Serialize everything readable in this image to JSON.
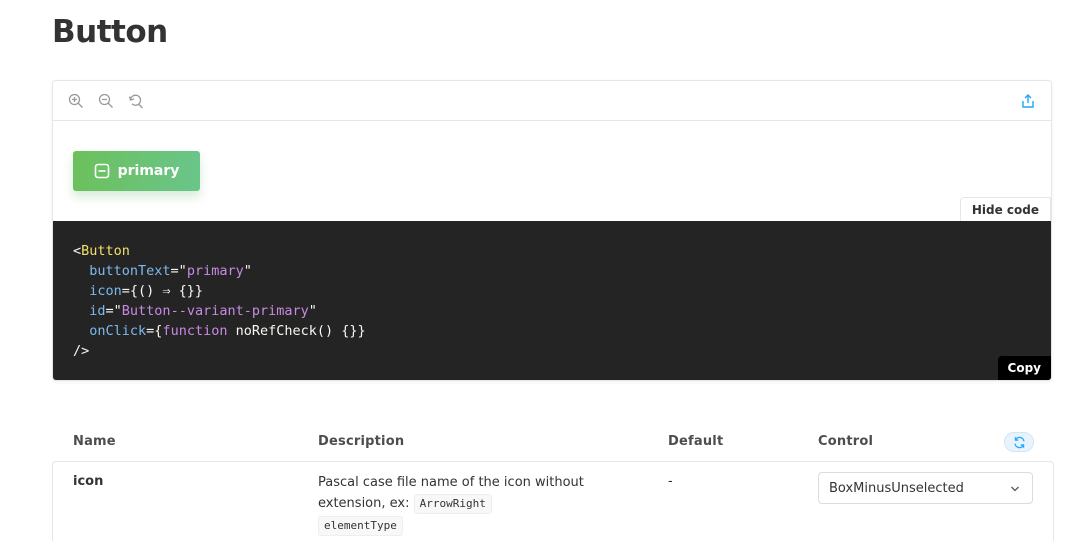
{
  "page": {
    "title": "Button"
  },
  "toolbar": {
    "icons": [
      "zoom-in-icon",
      "zoom-out-icon",
      "reset-zoom-icon",
      "share-icon"
    ],
    "accent": "#1ea7fd"
  },
  "preview": {
    "button_text": "primary",
    "button_icon": "box-minus-icon",
    "gradient": [
      "#6cc05c",
      "#6ac58a"
    ]
  },
  "code_actions": {
    "hide_code": "Hide code",
    "copy": "Copy"
  },
  "code": {
    "l1_open": "<",
    "l1_tag": "Button",
    "l2_attr": "buttonText",
    "l2_eq": "=\"",
    "l2_val": "primary",
    "l2_close": "\"",
    "l3_attr": "icon",
    "l3_val": "={() ⇒ {}}",
    "l4_attr": "id",
    "l4_eq": "=\"",
    "l4_val": "Button--variant-primary",
    "l4_close": "\"",
    "l5_attr": "onClick",
    "l5_open": "={",
    "l5_kw": "function",
    "l5_rest": " noRefCheck() {}}",
    "l6": "/>"
  },
  "props_table": {
    "headers": {
      "name": "Name",
      "description": "Description",
      "default": "Default",
      "control": "Control"
    },
    "rows": [
      {
        "name": "icon",
        "description": "Pascal case file name of the icon without extension, ex: ",
        "example": "ArrowRight",
        "type": "elementType",
        "default": "-",
        "control_value": "BoxMinusUnselected"
      }
    ]
  }
}
